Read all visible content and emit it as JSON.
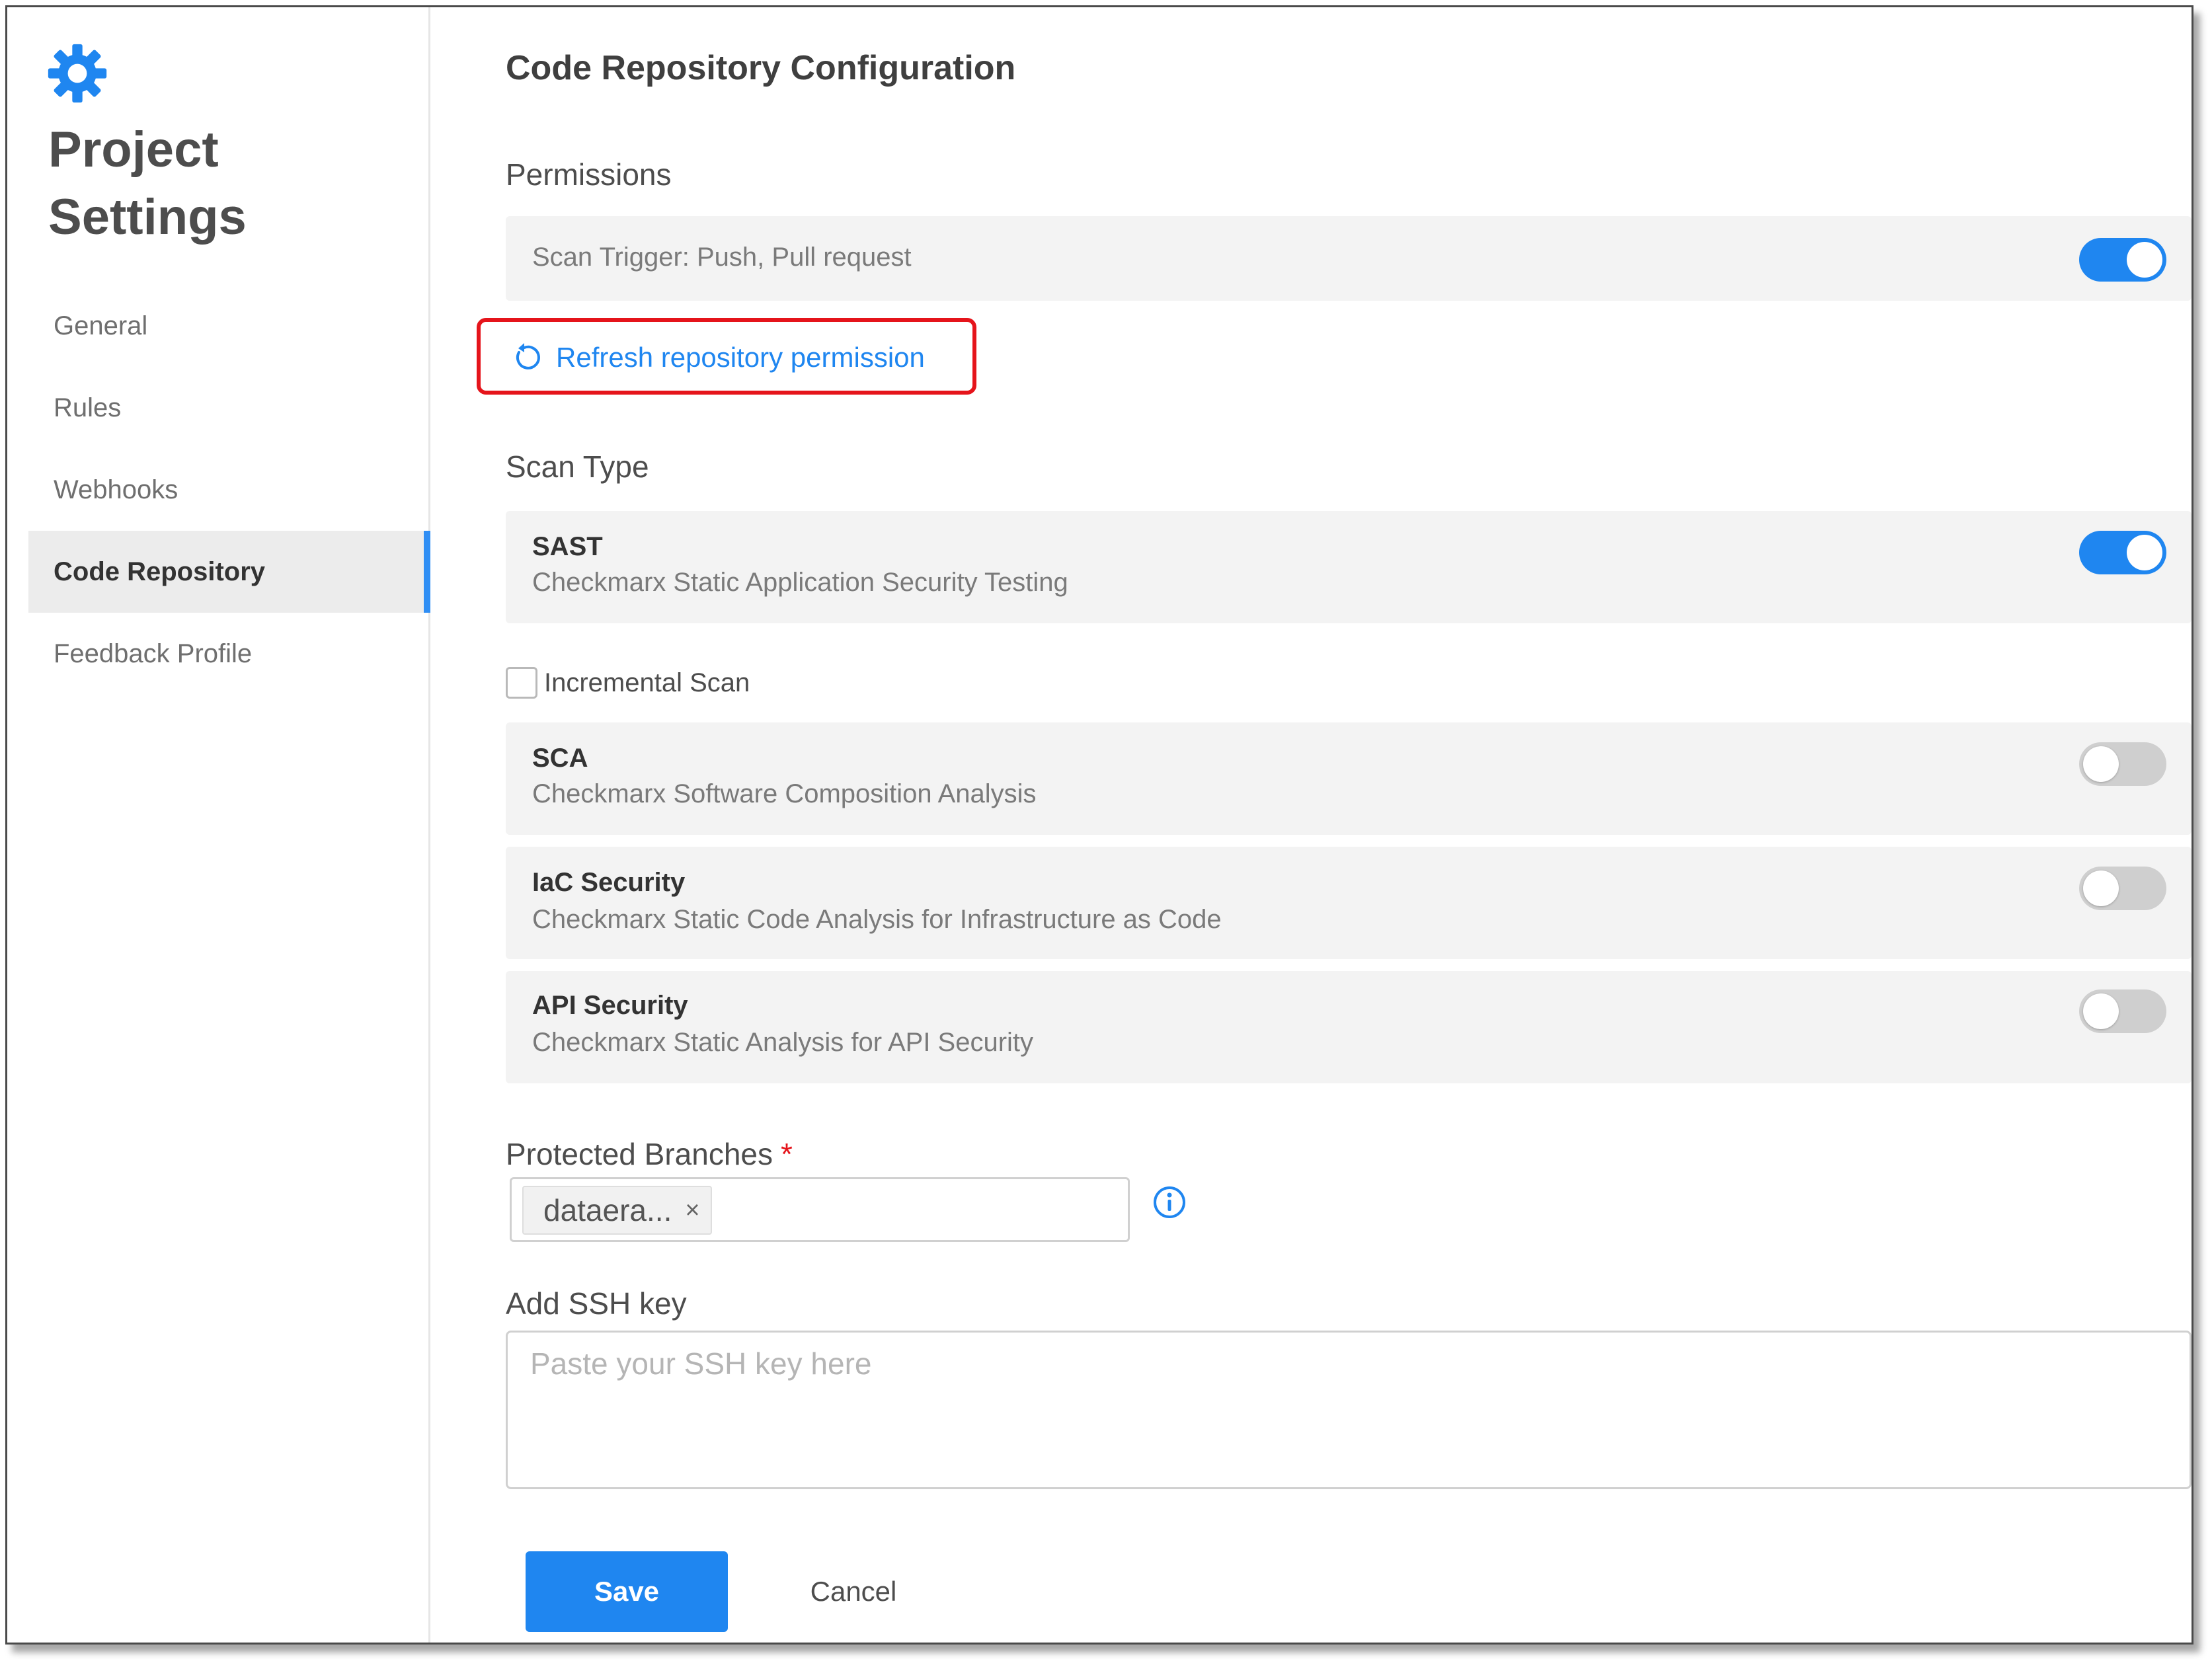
{
  "sidebar": {
    "title_line1": "Project",
    "title_line2": "Settings",
    "items": [
      {
        "label": "General"
      },
      {
        "label": "Rules"
      },
      {
        "label": "Webhooks"
      },
      {
        "label": "Code Repository",
        "active": true
      },
      {
        "label": "Feedback Profile"
      }
    ]
  },
  "main": {
    "title": "Code Repository Configuration",
    "permissions": {
      "label": "Permissions",
      "scan_trigger": "Scan Trigger: Push, Pull request",
      "scan_trigger_enabled": true,
      "refresh_link": "Refresh repository permission"
    },
    "scan_type": {
      "label": "Scan Type",
      "engines": [
        {
          "name": "SAST",
          "description": "Checkmarx Static Application Security Testing",
          "enabled": true
        },
        {
          "name": "SCA",
          "description": "Checkmarx Software Composition Analysis",
          "enabled": false
        },
        {
          "name": "IaC Security",
          "description": "Checkmarx Static Code Analysis for Infrastructure as Code",
          "enabled": false
        },
        {
          "name": "API Security",
          "description": "Checkmarx Static Analysis for API Security",
          "enabled": false
        }
      ],
      "incremental_scan_label": "Incremental Scan",
      "incremental_scan_checked": false
    },
    "protected_branches": {
      "label": "Protected Branches",
      "required_mark": "*",
      "tags": [
        "dataera..."
      ],
      "remove_glyph": "×"
    },
    "ssh": {
      "label": "Add SSH key",
      "value": "",
      "placeholder": "Paste your SSH key here"
    },
    "buttons": {
      "save": "Save",
      "cancel": "Cancel"
    }
  },
  "colors": {
    "accent": "#1f86f0",
    "highlight_box": "#e5141b",
    "card_bg": "#f3f3f3"
  },
  "icons": {
    "logo": "gear-icon",
    "refresh": "refresh-icon",
    "info": "info-icon",
    "tag_remove": "close-icon"
  }
}
